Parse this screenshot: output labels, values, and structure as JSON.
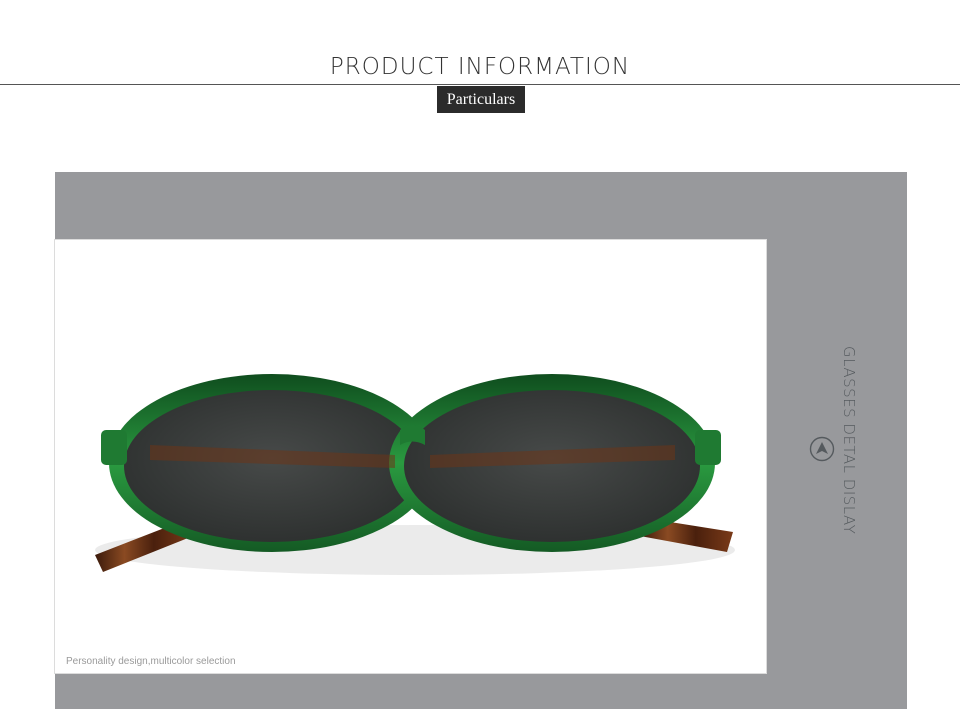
{
  "header": {
    "title": "PRODUCT INFORMATION",
    "tag": "Particulars"
  },
  "product": {
    "caption": "Personality design,multicolor selection",
    "side_label": "GLASSES DETAL DISLAY",
    "image": "green-oval-sunglasses-tortoiseshell-temples"
  },
  "colors": {
    "frame_green": "#1f7a32",
    "lens": "#3a3d3c",
    "tortoise": "#5a2a14",
    "panel_grey": "#98999c",
    "tag_bg": "#2b2b2b"
  },
  "icons": {
    "side_icon": "arrow-up-circle-icon"
  }
}
